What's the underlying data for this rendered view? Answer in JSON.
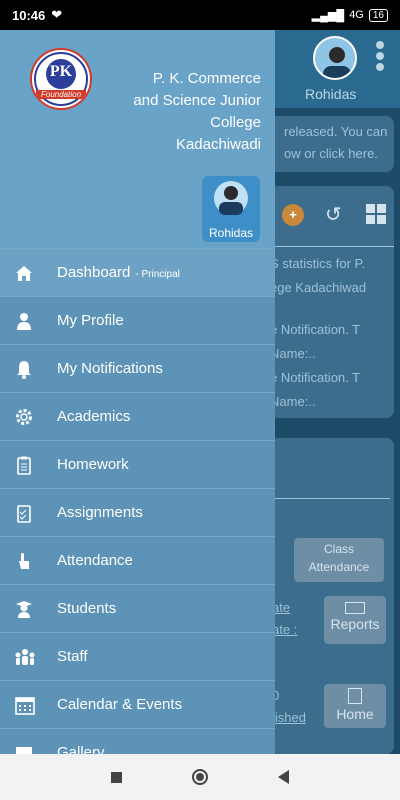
{
  "status_bar": {
    "time": "10:46",
    "network": "4G",
    "battery": "16"
  },
  "drawer": {
    "college_name_lines": [
      "P. K. Commerce",
      "and Science Junior",
      "College",
      "Kadachiwadi"
    ],
    "logo_text": "PK",
    "logo_caption": "Foundation",
    "user_name": "Rohidas",
    "menu": [
      {
        "label": "Dashboard",
        "sub": "- Principal",
        "icon": "home-icon"
      },
      {
        "label": "My Profile",
        "icon": "person-icon"
      },
      {
        "label": "My Notifications",
        "icon": "bell-icon"
      },
      {
        "label": "Academics",
        "icon": "gear-icon"
      },
      {
        "label": "Homework",
        "icon": "clipboard-icon"
      },
      {
        "label": "Assignments",
        "icon": "checklist-icon"
      },
      {
        "label": "Attendance",
        "icon": "hand-pointer-icon"
      },
      {
        "label": "Students",
        "icon": "graduate-icon"
      },
      {
        "label": "Staff",
        "icon": "group-icon"
      },
      {
        "label": "Calendar & Events",
        "icon": "calendar-icon"
      },
      {
        "label": "Gallery",
        "icon": "image-icon"
      }
    ]
  },
  "background": {
    "user_name": "Rohidas",
    "notice_lines": [
      "released. You can",
      "ow or click here."
    ],
    "feed_lines": [
      "S statistics for P.",
      "ege Kadachiwad",
      "e Notification. T",
      "Name:..",
      "e Notification. T",
      "Name:.."
    ],
    "tiles": {
      "class_attendance_line1": "Class",
      "class_attendance_line2": "Attendance",
      "reports": "Reports",
      "home": "Home",
      "published": "lished",
      "date1": "ate",
      "date2": "ate :",
      "count": "0"
    }
  },
  "colors": {
    "drawer": "#5c93b6",
    "drawer_header": "#6aa3c8",
    "background": "#1e4c68"
  }
}
